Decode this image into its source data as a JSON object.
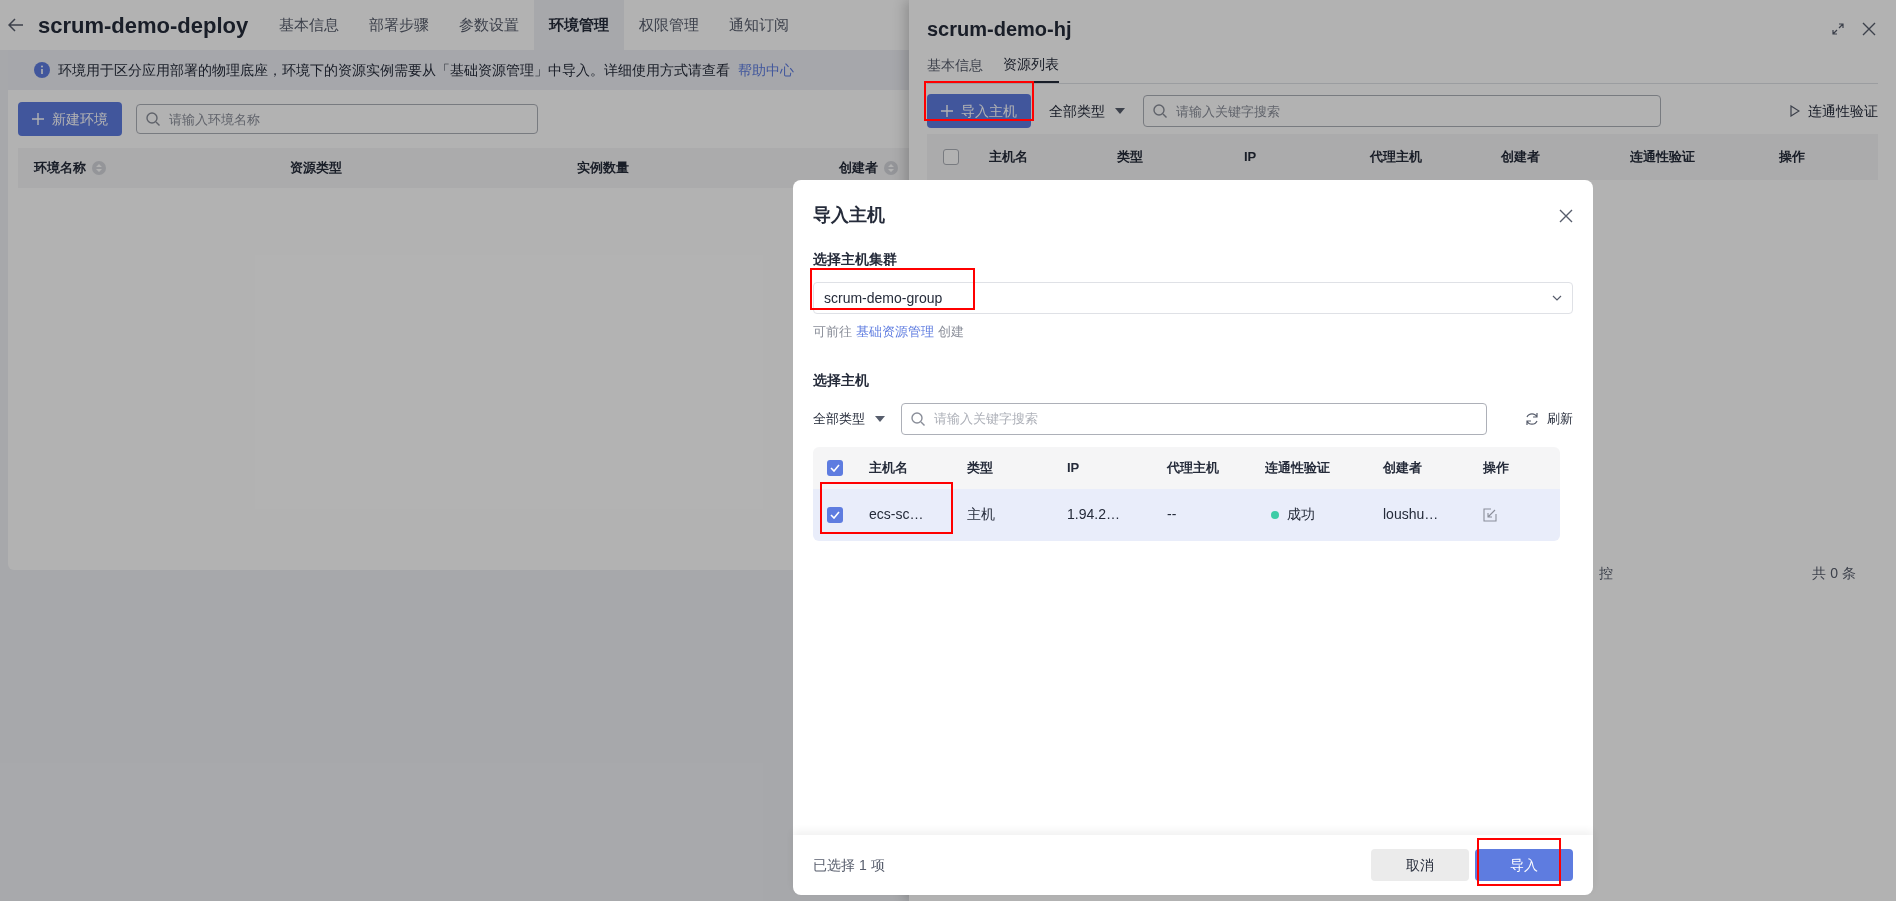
{
  "page": {
    "title": "scrum-demo-deploy",
    "tabs": [
      {
        "label": "基本信息",
        "selected": false
      },
      {
        "label": "部署步骤",
        "selected": false
      },
      {
        "label": "参数设置",
        "selected": false
      },
      {
        "label": "环境管理",
        "selected": true
      },
      {
        "label": "权限管理",
        "selected": false
      },
      {
        "label": "通知订阅",
        "selected": false
      }
    ],
    "info": {
      "text": "环境用于区分应用部署的物理底座，环境下的资源实例需要从「基础资源管理」中导入。详细使用方式请查看",
      "link": "帮助中心"
    },
    "new_button": "新建环境",
    "search": {
      "placeholder": "请输入环境名称"
    },
    "table": {
      "columns": [
        {
          "label": "环境名称",
          "sortable": true
        },
        {
          "label": "资源类型",
          "sortable": false
        },
        {
          "label": "实例数量",
          "sortable": false
        },
        {
          "label": "创建者",
          "sortable": true
        }
      ]
    }
  },
  "drawer": {
    "title": "scrum-demo-hj",
    "tabs": [
      {
        "label": "基本信息",
        "selected": false
      },
      {
        "label": "资源列表",
        "selected": true
      }
    ],
    "import_button": "导入主机",
    "type_filter": "全部类型",
    "search": {
      "placeholder": "请输入关键字搜索"
    },
    "verify_button": "连通性验证",
    "table": {
      "all_checked": false,
      "columns": [
        "主机名",
        "类型",
        "IP",
        "代理主机",
        "创建者",
        "连通性验证",
        "操作"
      ]
    },
    "partial_text": "控",
    "total": "共 0 条"
  },
  "dialog": {
    "title": "导入主机",
    "cluster_label": "选择主机集群",
    "cluster_select": {
      "value": "scrum-demo-group"
    },
    "hint": {
      "prefix": "可前往",
      "link": "基础资源管理",
      "suffix": "创建"
    },
    "hosts_label": "选择主机",
    "type_filter": "全部类型",
    "search": {
      "placeholder": "请输入关键字搜索"
    },
    "refresh_button": "刷新",
    "table": {
      "all_checked": true,
      "columns": [
        "主机名",
        "类型",
        "IP",
        "代理主机",
        "连通性验证",
        "创建者",
        "操作"
      ],
      "rows": [
        {
          "checked": true,
          "host": "ecs-sc…",
          "type": "主机",
          "ip": "1.94.2…",
          "proxy": "--",
          "status": "成功",
          "creator": "loushu…"
        }
      ]
    },
    "footer": {
      "selected_count": "已选择 1 项",
      "cancel": "取消",
      "confirm": "导入"
    }
  }
}
